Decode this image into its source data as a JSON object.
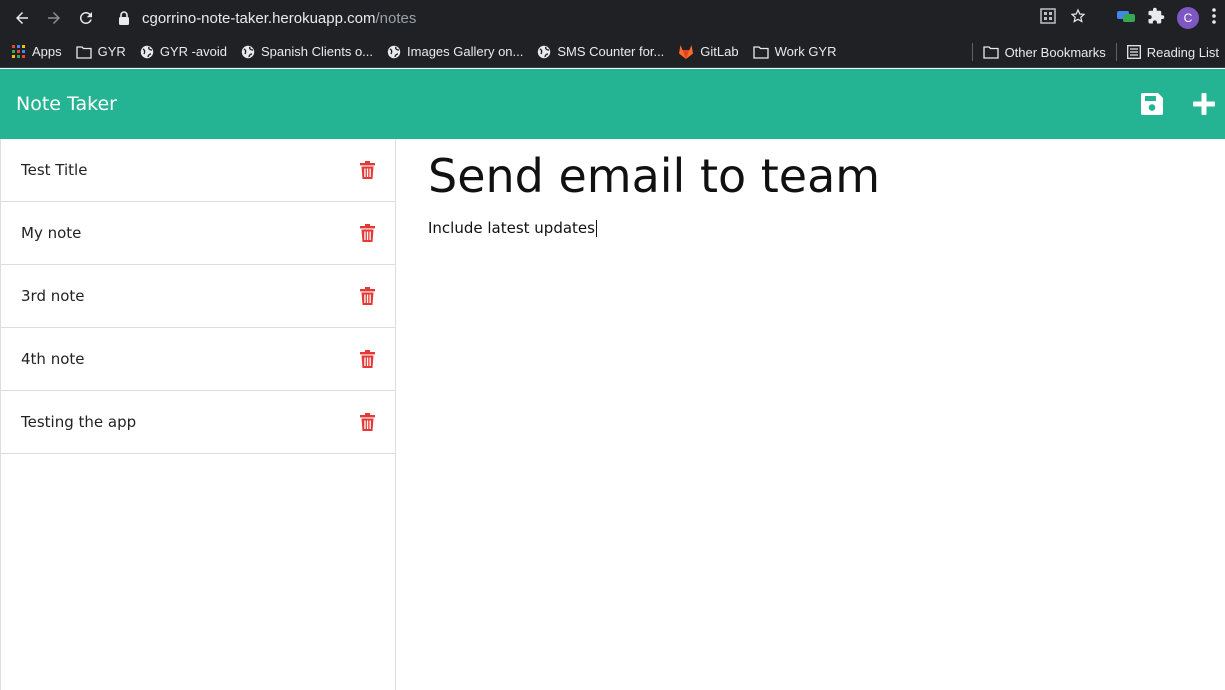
{
  "browser": {
    "url_host": "cgorrino-note-taker.herokuapp.com",
    "url_path": "/notes",
    "avatar_initial": "C",
    "bookmarks": [
      {
        "label": "Apps",
        "icon": "apps-grid-icon"
      },
      {
        "label": "GYR",
        "icon": "folder-icon"
      },
      {
        "label": "GYR -avoid",
        "icon": "globe-icon"
      },
      {
        "label": "Spanish Clients o...",
        "icon": "globe-icon"
      },
      {
        "label": "Images Gallery on...",
        "icon": "globe-icon"
      },
      {
        "label": "SMS Counter for...",
        "icon": "globe-icon"
      },
      {
        "label": "GitLab",
        "icon": "gitlab-icon"
      },
      {
        "label": "Work GYR",
        "icon": "folder-icon"
      }
    ],
    "bookmarks_right": [
      {
        "label": "Other Bookmarks",
        "icon": "folder-icon"
      },
      {
        "label": "Reading List",
        "icon": "reading-list-icon"
      }
    ]
  },
  "app": {
    "brand": "Note Taker",
    "accent_color": "#24b493",
    "delete_color": "#e53935"
  },
  "notes": [
    {
      "title": "Test Title"
    },
    {
      "title": "My note"
    },
    {
      "title": "3rd note"
    },
    {
      "title": "4th note"
    },
    {
      "title": "Testing the app"
    }
  ],
  "editor": {
    "title": "Send email to team",
    "body": "Include latest updates"
  }
}
